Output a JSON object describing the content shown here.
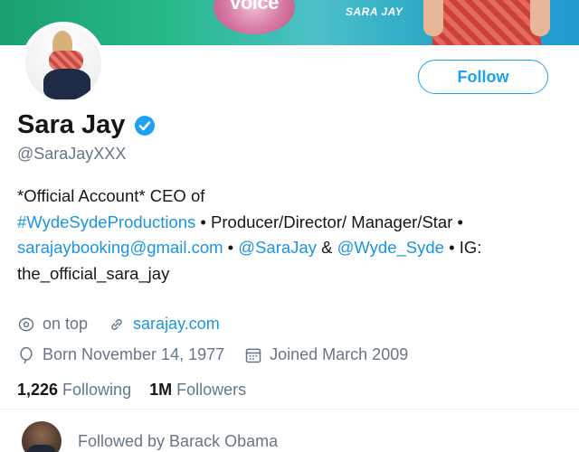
{
  "banner": {
    "logo_text": "voice",
    "caption": "SARA JAY"
  },
  "profile": {
    "display_name": "Sara Jay",
    "handle": "@SaraJayXXX",
    "verified": true,
    "follow_label": "Follow"
  },
  "bio": {
    "part1": "*Official Account* CEO of",
    "hashtag": "#WydeSydeProductions",
    "part2": " • Producer/Director/ Manager/Star • ",
    "email": "sarajaybooking@gmail.com",
    "part3": " • ",
    "mention1": "@SaraJay",
    "part4": " & ",
    "mention2": "@Wyde_Syde",
    "part5": " • IG: the_official_sara_jay"
  },
  "meta": {
    "location": "on top",
    "website": "sarajay.com",
    "birthday": "Born November 14, 1977",
    "joined": "Joined March 2009"
  },
  "counts": {
    "following_num": "1,226",
    "following_label": "Following",
    "followers_num": "1M",
    "followers_label": "Followers"
  },
  "followed_by": {
    "text": "Followed by Barack Obama"
  },
  "colors": {
    "accent": "#1da1f2",
    "link": "#1b95e0",
    "muted": "#657786",
    "text": "#14171a"
  },
  "icons": [
    "location-icon",
    "link-icon",
    "balloon-icon",
    "calendar-icon",
    "verified-badge-icon"
  ]
}
